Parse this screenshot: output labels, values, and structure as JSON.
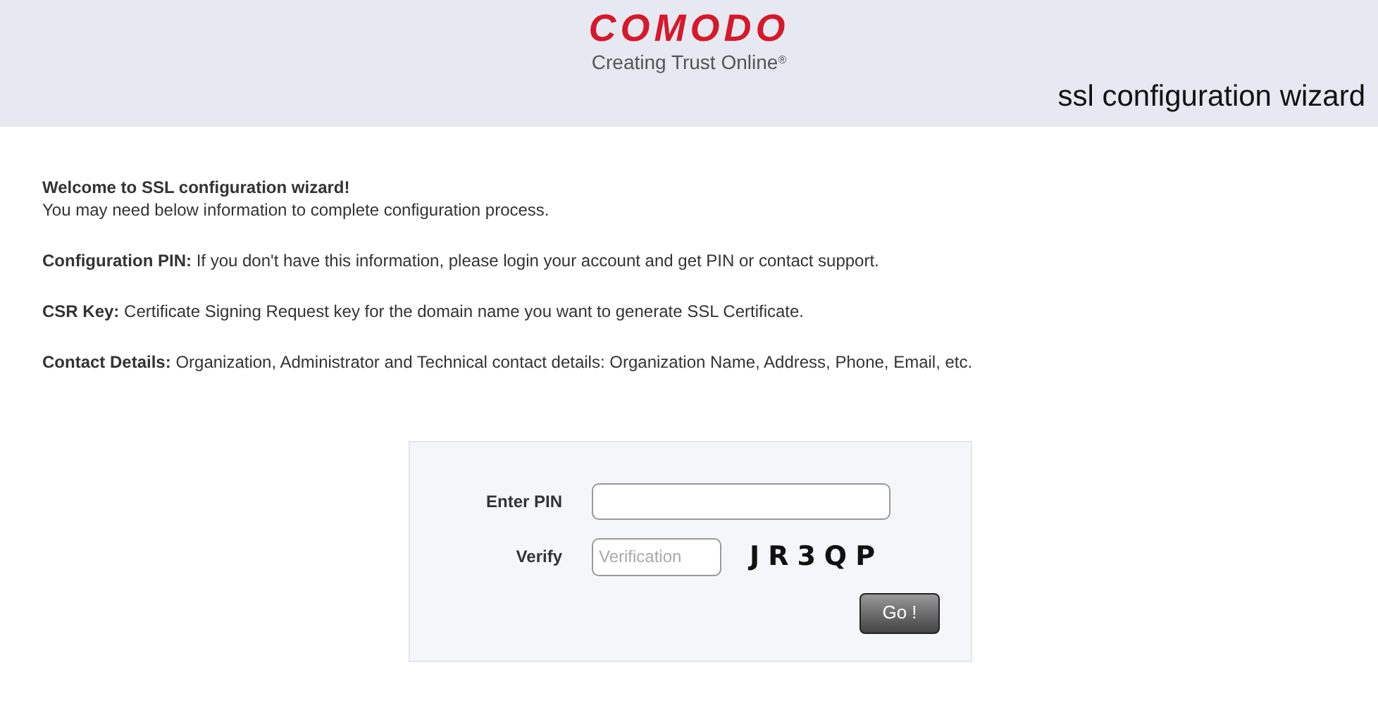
{
  "header": {
    "logo": "COMODO",
    "tagline": "Creating Trust Online",
    "tagline_mark": "®",
    "title": "ssl configuration wizard"
  },
  "intro": {
    "heading": "Welcome to SSL configuration wizard!",
    "text": "You may need below information to complete configuration process."
  },
  "paragraphs": [
    "**Configuration PIN:** If you don't have this information, please login your account and get PIN or contact support.",
    "**CSR Key:** Certificate Signing Request key for the domain name you want to generate SSL Certificate.",
    "**Contact Details:** Organization, Administrator and Technical contact details: Organization Name, Address, Phone, Email, etc."
  ],
  "form": {
    "pin_label": "Enter PIN",
    "verify_label": "Verify",
    "verify_placeholder": "Verification",
    "captcha": "JR3QP",
    "submit": "Go !"
  }
}
